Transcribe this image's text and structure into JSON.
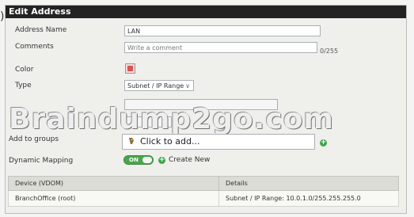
{
  "dialog": {
    "title": "Edit Address"
  },
  "form": {
    "address_name": {
      "label": "Address Name",
      "value": "LAN"
    },
    "comments": {
      "label": "Comments",
      "placeholder": "Write a comment",
      "counter": "0/255"
    },
    "color": {
      "label": "Color",
      "value_hex": "#d9534f"
    },
    "type": {
      "label": "Type",
      "selected": "Subnet / IP Range"
    },
    "add_to_groups": {
      "label": "Add to groups",
      "value": "Click to add..."
    },
    "dynamic_mapping": {
      "label": "Dynamic Mapping",
      "toggle_label": "ON",
      "create_new_label": "Create New"
    }
  },
  "watermark": "Braindump2go.com",
  "mapping_table": {
    "columns": [
      "Device (VDOM)",
      "Details"
    ],
    "rows": [
      [
        "BranchOffice (root)",
        "Subnet / IP Range: 10.0.1.0/255.255.255.0"
      ]
    ]
  },
  "colors": {
    "title_bar": "#232323",
    "toggle_on": "#4aa64a",
    "add_icon": "#3fa34d"
  }
}
